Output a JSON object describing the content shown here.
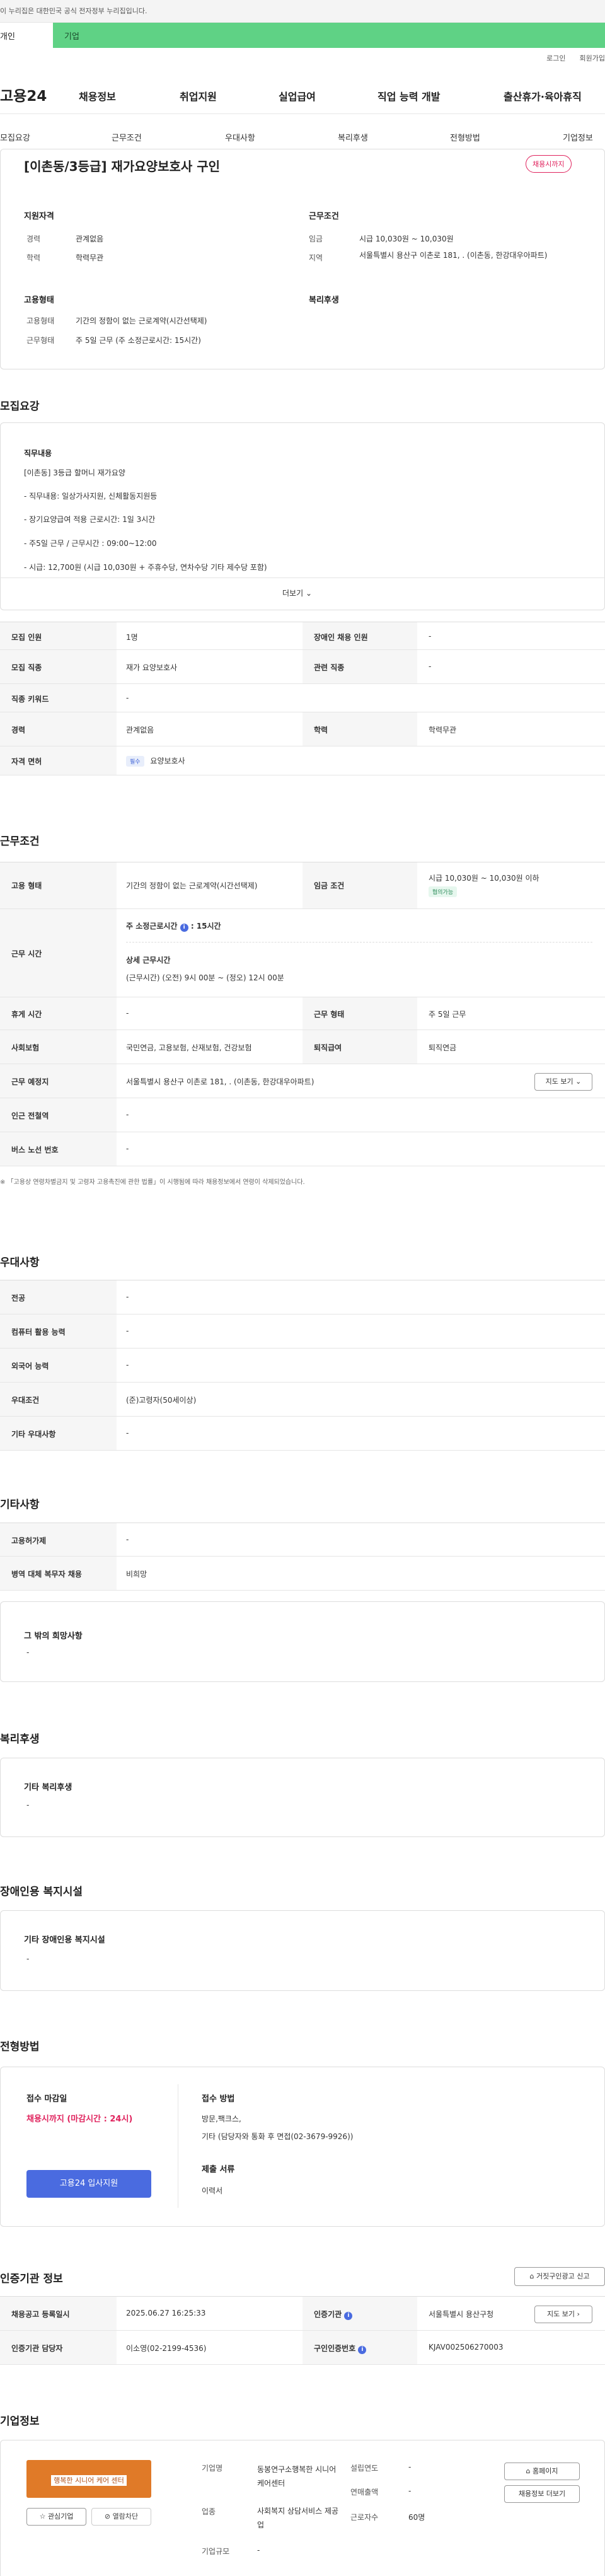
{
  "gov_banner": "이 누리집은 대한민국 공식 전자정부 누리집입니다.",
  "top_tabs": {
    "personal": "개인",
    "company": "기업"
  },
  "util": {
    "login": "로그인",
    "join": "회원가입"
  },
  "logo": "고용24",
  "gnb": [
    "채용정보",
    "취업지원",
    "실업급여",
    "직업 능력 개발",
    "출산휴가·육아휴직"
  ],
  "anchors": [
    "모집요강",
    "근무조건",
    "우대사항",
    "복리후생",
    "전형방법",
    "기업정보"
  ],
  "header": {
    "title": "[이촌동/3등급] 재가요양보호사 구인",
    "status_badge": "채용시까지",
    "qual_title": "지원자격",
    "cond_title": "근무조건",
    "career_label": "경력",
    "career_value": "관계없음",
    "edu_label": "학력",
    "edu_value": "학력무관",
    "wage_label": "임금",
    "wage_value": "시급 10,030원 ~ 10,030원",
    "region_label": "지역",
    "region_value": "서울특별시 용산구 이촌로 181, . (이촌동, 한강대우아파트)",
    "empform_title": "고용형태",
    "welfare_title": "복리후생",
    "emptype_label": "고용형태",
    "emptype_value": "기간의 정함이 없는 근로계약(시간선택제)",
    "workform_label": "근무형태",
    "workform_value": "주 5일 근무 (주 소정근로시간: 15시간)"
  },
  "recruit": {
    "section_title": "모집요강",
    "desc_title": "직무내용",
    "desc_lines": [
      "[이촌동] 3등급 할머니 재가요양",
      "- 직무내용: 일상가사지원, 신체활동지원등",
      "- 장기요양급여 적용 근로시간: 1일 3시간",
      "- 주5일 근무 / 근무시간 : 09:00~12:00",
      "- 시급: 12,700원 (시급 10,030원 + 주휴수당, 연차수당 기타 제수당 포함)"
    ],
    "more": "더보기",
    "rows": {
      "count_label": "모집 인원",
      "count_value": "1명",
      "disabled_label": "장애인 채용 인원",
      "disabled_value": "-",
      "job_label": "모집 직종",
      "job_value": "재가 요양보호사",
      "related_label": "관련 직종",
      "related_value": "-",
      "keyword_label": "직종 키워드",
      "keyword_value": "-",
      "career_label": "경력",
      "career_value": "관계없음",
      "edu_label": "학력",
      "edu_value": "학력무관",
      "license_label": "자격 면허",
      "license_chip": "필수",
      "license_value": "요양보호사"
    }
  },
  "work": {
    "section_title": "근무조건",
    "emptype_label": "고용 형태",
    "emptype_value": "기간의 정함이 없는 근로계약(시간선택제)",
    "wage_label": "임금 조건",
    "wage_value": "시급 10,030원 ~ 10,030원 이하",
    "wage_chip": "협의가능",
    "time_label": "근무 시간",
    "time_weekly": "주 소정근로시간",
    "time_weekly_value": "15시간",
    "time_detail_title": "상세 근무시간",
    "time_detail_value": "(근무시간) (오전) 9시 00분 ~ (정오) 12시 00분",
    "rest_label": "휴게 시간",
    "rest_value": "-",
    "form_label": "근무 형태",
    "form_value": "주 5일 근무",
    "insure_label": "사회보험",
    "insure_value": "국민연금, 고용보험, 산재보험, 건강보험",
    "retire_label": "퇴직급여",
    "retire_value": "퇴직연금",
    "place_label": "근무 예정지",
    "place_value": "서울특별시 용산구 이촌로 181, . (이촌동, 한강대우아파트)",
    "map_btn": "지도 보기",
    "subway_label": "인근 전철역",
    "subway_value": "-",
    "bus_label": "버스 노선 번호",
    "bus_value": "-",
    "notice": "※ 「고용상 연령차별금지 및 고령자 고용촉진에 관한 법률」이 시행됨에 따라 채용정보에서 연령이 삭제되었습니다."
  },
  "pref": {
    "section_title": "우대사항",
    "major_label": "전공",
    "major_value": "-",
    "pc_label": "컴퓨터 활용 능력",
    "pc_value": "-",
    "lang_label": "외국어 능력",
    "lang_value": "-",
    "cond_label": "우대조건",
    "cond_value": "(준)고령자(50세이상)",
    "etc_label": "기타 우대사항",
    "etc_value": "-"
  },
  "other": {
    "section_title": "기타사항",
    "permit_label": "고용허가제",
    "permit_value": "-",
    "military_label": "병역 대체 복무자 채용",
    "military_value": "비희망",
    "wish_title": "그 밖의 희망사항",
    "wish_value": "-"
  },
  "welfare": {
    "section_title": "복리후생",
    "box_title": "기타 복리후생",
    "box_value": "-"
  },
  "disabled": {
    "section_title": "장애인용 복지시설",
    "box_title": "기타 장애인용 복지시설",
    "box_value": "-"
  },
  "selection": {
    "section_title": "전형방법",
    "deadline_title": "접수 마감일",
    "deadline_value": "채용시까지 (마감시간 : 24시)",
    "apply_btn": "고용24 입사지원",
    "method_title": "접수 방법",
    "method_value1": "방문,팩크스,",
    "method_value2": "기타 (담당자와 통화 후 면접(02-3679-9926))",
    "docs_title": "제출 서류",
    "docs_value": "이력서"
  },
  "agency": {
    "section_title": "인증기관 정보",
    "report_btn": "거짓구인광고 신고",
    "reg_label": "채용공고 등록일시",
    "reg_value": "2025.06.27 16:25:33",
    "org_label": "인증기관",
    "org_value": "서울특별시 용산구청",
    "map_btn": "지도 보기",
    "mgr_label": "인증기관 담당자",
    "mgr_value": "이소영(02-2199-4536)",
    "no_label": "구인인증번호",
    "no_value": "KJAV002506270003"
  },
  "company": {
    "section_title": "기업정보",
    "logo_text": "행복한 시니어 케어 센터",
    "interest_btn": "관심기업",
    "block_btn": "열람차단",
    "name_label": "기업명",
    "name_value": "동봉연구소행복한 시니어케어센터",
    "industry_label": "업종",
    "industry_value": "사회복지 상담서비스 제공업",
    "scale_label": "기업규모",
    "scale_value": "-",
    "founded_label": "설립연도",
    "founded_value": "-",
    "sales_label": "연매출액",
    "sales_value": "-",
    "emp_label": "근로자수",
    "emp_value": "60명",
    "homepage_btn": "홈페이지",
    "jobs_btn": "채용정보 더보기"
  },
  "colors": {
    "accent_green": "#5fd285",
    "brand_blue": "#4a6be0",
    "alert_red": "#e0245e"
  }
}
